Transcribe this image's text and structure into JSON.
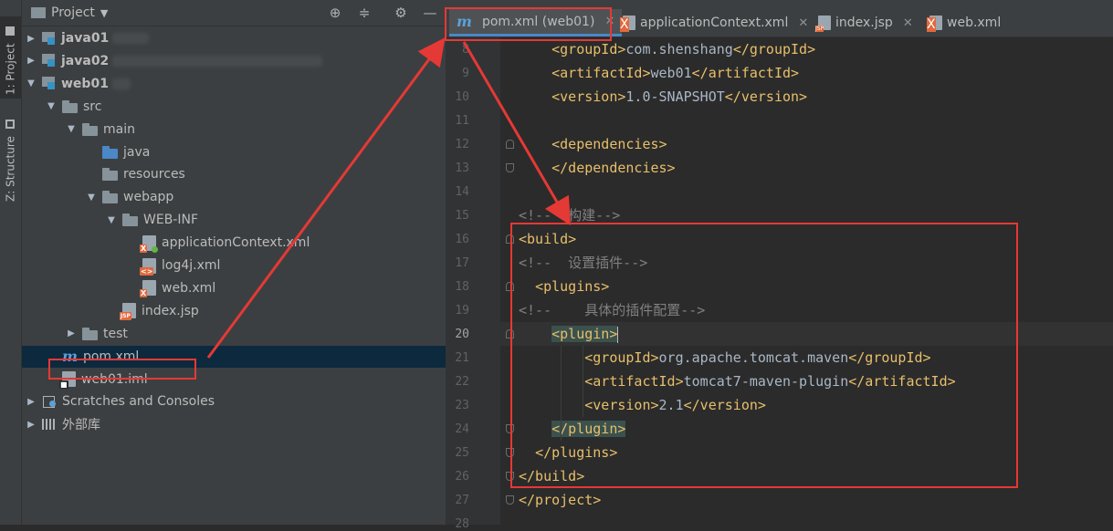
{
  "side_strip": {
    "project_tab": "1: Project",
    "structure_tab": "Z: Structure"
  },
  "project_panel": {
    "title": "Project",
    "tree": [
      {
        "label": "java01",
        "indent": 0,
        "arrow": "▶",
        "icon": "module",
        "bold": true
      },
      {
        "label": "java02",
        "indent": 0,
        "arrow": "▶",
        "icon": "module",
        "bold": true
      },
      {
        "label": "web01",
        "indent": 0,
        "arrow": "▼",
        "icon": "module",
        "bold": true
      },
      {
        "label": "src",
        "indent": 1,
        "arrow": "▼",
        "icon": "folder"
      },
      {
        "label": "main",
        "indent": 2,
        "arrow": "▼",
        "icon": "folder"
      },
      {
        "label": "java",
        "indent": 3,
        "arrow": "",
        "icon": "folder-blue"
      },
      {
        "label": "resources",
        "indent": 3,
        "arrow": "",
        "icon": "folder-res"
      },
      {
        "label": "webapp",
        "indent": 3,
        "arrow": "▼",
        "icon": "folder-web"
      },
      {
        "label": "WEB-INF",
        "indent": 4,
        "arrow": "▼",
        "icon": "folder"
      },
      {
        "label": "applicationContext.xml",
        "indent": 5,
        "arrow": "",
        "icon": "spring-xml"
      },
      {
        "label": "log4j.xml",
        "indent": 5,
        "arrow": "",
        "icon": "xml"
      },
      {
        "label": "web.xml",
        "indent": 5,
        "arrow": "",
        "icon": "web-xml"
      },
      {
        "label": "index.jsp",
        "indent": 4,
        "arrow": "",
        "icon": "jsp"
      },
      {
        "label": "test",
        "indent": 2,
        "arrow": "▶",
        "icon": "folder"
      },
      {
        "label": "pom.xml",
        "indent": 1,
        "arrow": "",
        "icon": "maven",
        "selected": true
      },
      {
        "label": "web01.iml",
        "indent": 1,
        "arrow": "",
        "icon": "iml"
      },
      {
        "label": "Scratches and Consoles",
        "indent": 0,
        "arrow": "▶",
        "icon": "scratch"
      },
      {
        "label": "外部库",
        "indent": 0,
        "arrow": "▶",
        "icon": "library"
      }
    ]
  },
  "tabs": [
    {
      "label": "pom.xml (web01)",
      "icon": "maven",
      "active": true
    },
    {
      "label": "applicationContext.xml",
      "icon": "spring-xml"
    },
    {
      "label": "index.jsp",
      "icon": "jsp"
    },
    {
      "label": "web.xml",
      "icon": "web-xml"
    }
  ],
  "editor": {
    "current_line": 20,
    "lines": [
      {
        "n": 8,
        "tokens": [
          [
            "    ",
            "txt"
          ],
          [
            "<groupId>",
            "tag"
          ],
          [
            "com.shenshang",
            "txt"
          ],
          [
            "</groupId>",
            "tag"
          ]
        ]
      },
      {
        "n": 9,
        "tokens": [
          [
            "    ",
            "txt"
          ],
          [
            "<artifactId>",
            "tag"
          ],
          [
            "web01",
            "txt"
          ],
          [
            "</artifactId>",
            "tag"
          ]
        ]
      },
      {
        "n": 10,
        "tokens": [
          [
            "    ",
            "txt"
          ],
          [
            "<version>",
            "tag"
          ],
          [
            "1.0-SNAPSHOT",
            "txt"
          ],
          [
            "</version>",
            "tag"
          ]
        ]
      },
      {
        "n": 11,
        "tokens": []
      },
      {
        "n": 12,
        "tokens": [
          [
            "    ",
            "txt"
          ],
          [
            "<dependencies>",
            "tag"
          ]
        ]
      },
      {
        "n": 13,
        "tokens": [
          [
            "    ",
            "txt"
          ],
          [
            "</dependencies>",
            "tag"
          ]
        ]
      },
      {
        "n": 14,
        "tokens": []
      },
      {
        "n": 15,
        "tokens": [
          [
            "<!--  构建-->",
            "cmt"
          ]
        ]
      },
      {
        "n": 16,
        "tokens": [
          [
            "<build>",
            "tag"
          ]
        ]
      },
      {
        "n": 17,
        "tokens": [
          [
            "<!--  设置插件-->",
            "cmt"
          ]
        ]
      },
      {
        "n": 18,
        "tokens": [
          [
            "  ",
            "txt"
          ],
          [
            "<plugins>",
            "tag"
          ]
        ]
      },
      {
        "n": 19,
        "tokens": [
          [
            "<!--    具体的插件配置-->",
            "cmt"
          ]
        ]
      },
      {
        "n": 20,
        "tokens": [
          [
            "    ",
            "txt"
          ],
          [
            "<plugin>",
            "tag hlb"
          ]
        ]
      },
      {
        "n": 21,
        "tokens": [
          [
            "        ",
            "txt"
          ],
          [
            "<groupId>",
            "tag"
          ],
          [
            "org.apache.tomcat.maven",
            "txt"
          ],
          [
            "</groupId>",
            "tag"
          ]
        ]
      },
      {
        "n": 22,
        "tokens": [
          [
            "        ",
            "txt"
          ],
          [
            "<artifactId>",
            "tag"
          ],
          [
            "tomcat7-maven-plugin",
            "txt"
          ],
          [
            "</artifactId>",
            "tag"
          ]
        ]
      },
      {
        "n": 23,
        "tokens": [
          [
            "        ",
            "txt"
          ],
          [
            "<version>",
            "tag"
          ],
          [
            "2.1",
            "txt"
          ],
          [
            "</version>",
            "tag"
          ]
        ]
      },
      {
        "n": 24,
        "tokens": [
          [
            "    ",
            "txt"
          ],
          [
            "</plugin>",
            "tag hlb"
          ]
        ]
      },
      {
        "n": 25,
        "tokens": [
          [
            "  ",
            "txt"
          ],
          [
            "</plugins>",
            "tag"
          ]
        ]
      },
      {
        "n": 26,
        "tokens": [
          [
            "</build>",
            "tag"
          ]
        ]
      },
      {
        "n": 27,
        "tokens": [
          [
            "</project>",
            "tag"
          ]
        ]
      },
      {
        "n": 28,
        "tokens": []
      }
    ]
  },
  "colors": {
    "annotation": "#e53935",
    "tag": "#e8bf6a",
    "text": "#a9b7c6",
    "comment": "#808080",
    "selection": "#0d293e"
  }
}
